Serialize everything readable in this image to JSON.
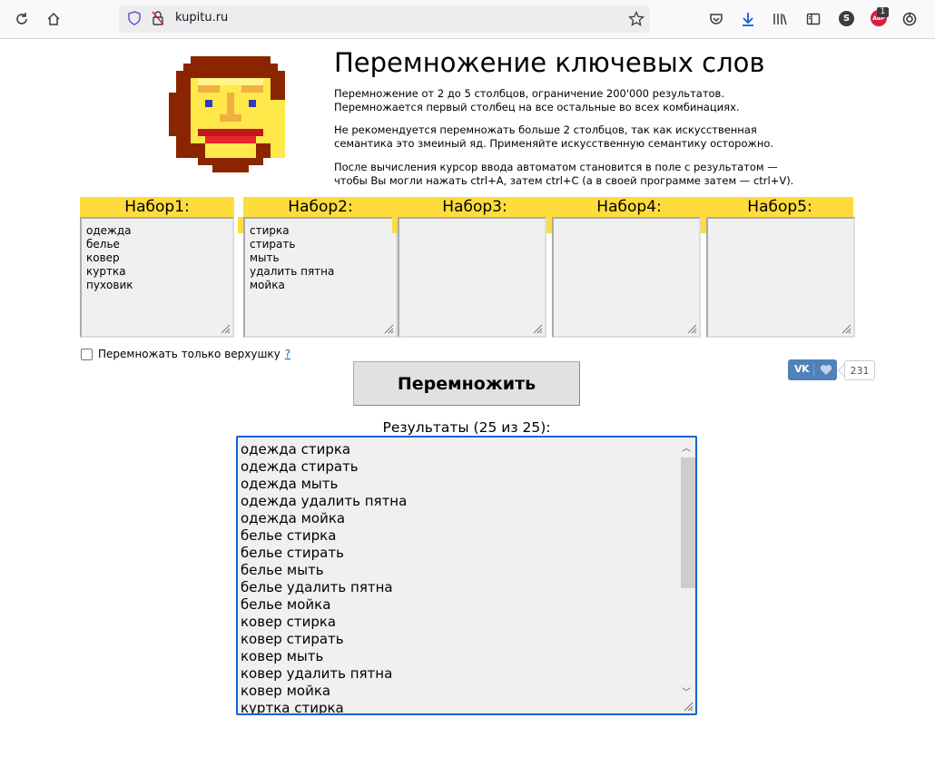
{
  "browser": {
    "url": "kupitu.ru",
    "sync_badge": "S",
    "abp_label": "ABP",
    "abp_count": "1"
  },
  "page": {
    "title": "Перемножение ключевых слов",
    "desc1": [
      "Перемножение от 2 до 5 столбцов, ограничение 200'000 результатов.",
      "Перемножается первый столбец на все остальные во всех комбинациях."
    ],
    "desc2": [
      "Не рекомендуется перемножать больше 2 столбцов, так как искусственная",
      "семантика это змеиный яд. Применяйте искусственную семантику осторожно."
    ],
    "desc3": [
      "После вычисления курсор ввода автоматом становится в поле с результатом —",
      "чтобы Вы могли нажать ctrl+A, затем ctrl+C (а в своей программе затем — ctrl+V)."
    ]
  },
  "sets": [
    {
      "label": "Набор1:",
      "items": [
        "одежда",
        "белье",
        "ковер",
        "куртка",
        "пуховик"
      ]
    },
    {
      "label": "Набор2:",
      "items": [
        "стирка",
        "стирать",
        "мыть",
        "удалить пятна",
        "мойка"
      ]
    },
    {
      "label": "Набор3:",
      "items": []
    },
    {
      "label": "Набор4:",
      "items": []
    },
    {
      "label": "Набор5:",
      "items": []
    }
  ],
  "options": {
    "top_only_label": "Перемножать только верхушку",
    "help_link": "?"
  },
  "multiply_button": "Перемножить",
  "vk": {
    "logo": "VK",
    "count": "231"
  },
  "results": {
    "label": "Результаты (25 из 25):",
    "lines": [
      "одежда стирка",
      "одежда стирать",
      "одежда мыть",
      "одежда удалить пятна",
      "одежда мойка",
      "белье стирка",
      "белье стирать",
      "белье мыть",
      "белье удалить пятна",
      "белье мойка",
      "ковер стирка",
      "ковер стирать",
      "ковер мыть",
      "ковер удалить пятна",
      "ковер мойка",
      "куртка стирка"
    ]
  },
  "colors": {
    "accent_yellow": "#fddc3c",
    "results_border": "#0a63d6",
    "vk_blue": "#5181b8"
  }
}
